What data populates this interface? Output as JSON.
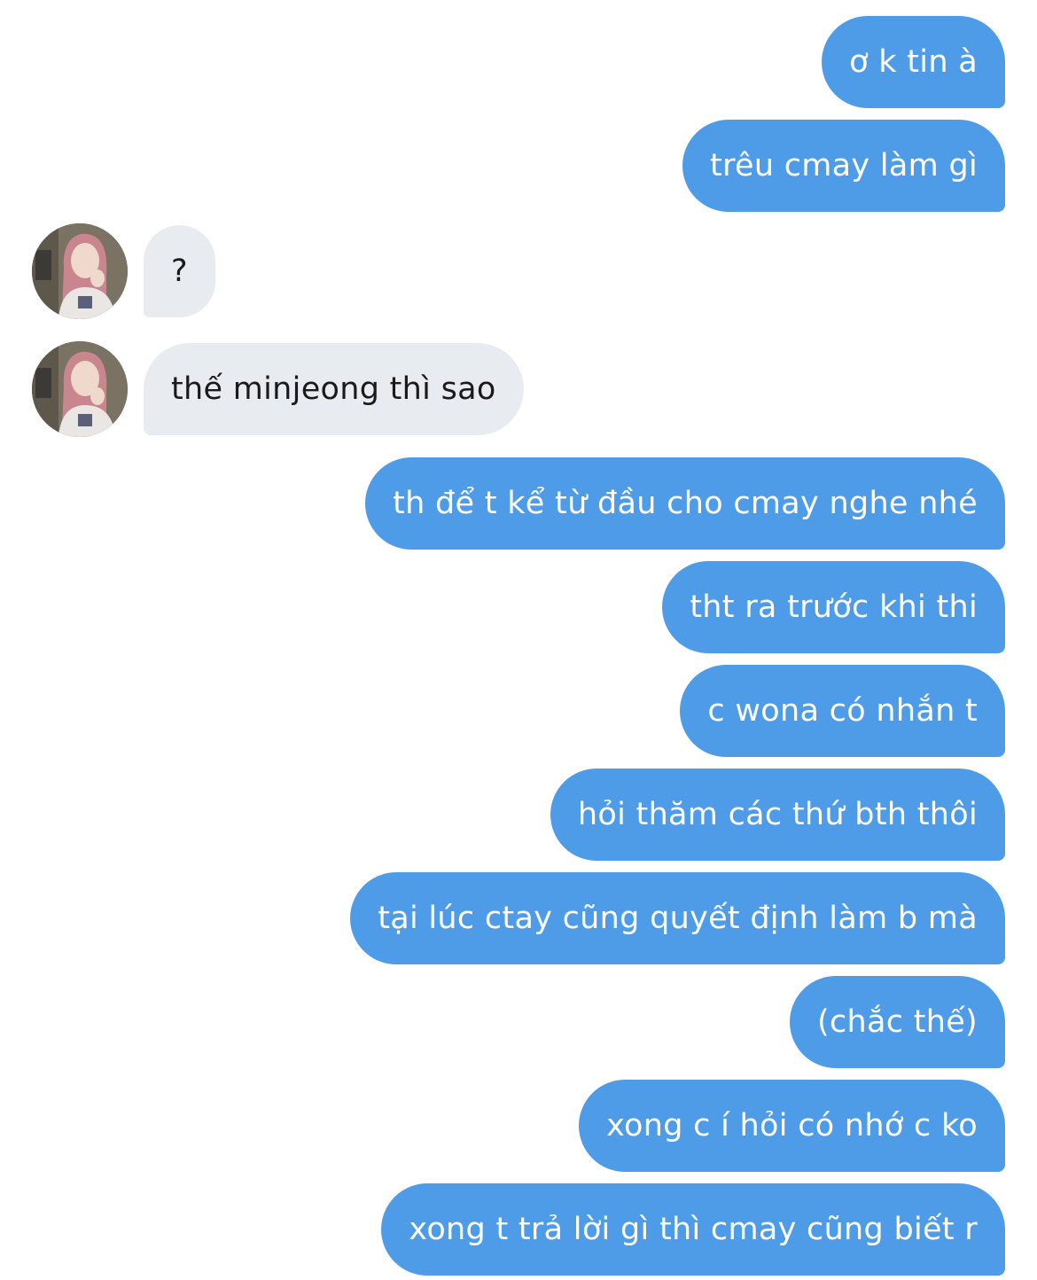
{
  "messages": [
    {
      "direction": "out",
      "text": "ơ k tin à"
    },
    {
      "direction": "out",
      "text": "trêu cmay làm gì"
    },
    {
      "direction": "in",
      "text": "?"
    },
    {
      "direction": "in",
      "text": "thế minjeong thì sao"
    },
    {
      "direction": "out",
      "text": "th để t kể từ đầu cho cmay nghe nhé"
    },
    {
      "direction": "out",
      "text": "tht ra trước khi thi"
    },
    {
      "direction": "out",
      "text": "c wona có nhắn t"
    },
    {
      "direction": "out",
      "text": "hỏi thăm các thứ bth thôi"
    },
    {
      "direction": "out",
      "text": "tại lúc ctay cũng quyết định làm b mà"
    },
    {
      "direction": "out",
      "text": "(chắc thế)"
    },
    {
      "direction": "out",
      "text": "xong c í hỏi có nhớ c ko"
    },
    {
      "direction": "out",
      "text": "xong t trả lời gì thì cmay cũng biết r"
    }
  ],
  "colors": {
    "outgoing_bubble": "#4e9ce8",
    "incoming_bubble": "#e8ecf0",
    "outgoing_text": "#ffffff",
    "incoming_text": "#1a1a1a"
  },
  "icons": {
    "contact_avatar": "avatar-photo"
  }
}
